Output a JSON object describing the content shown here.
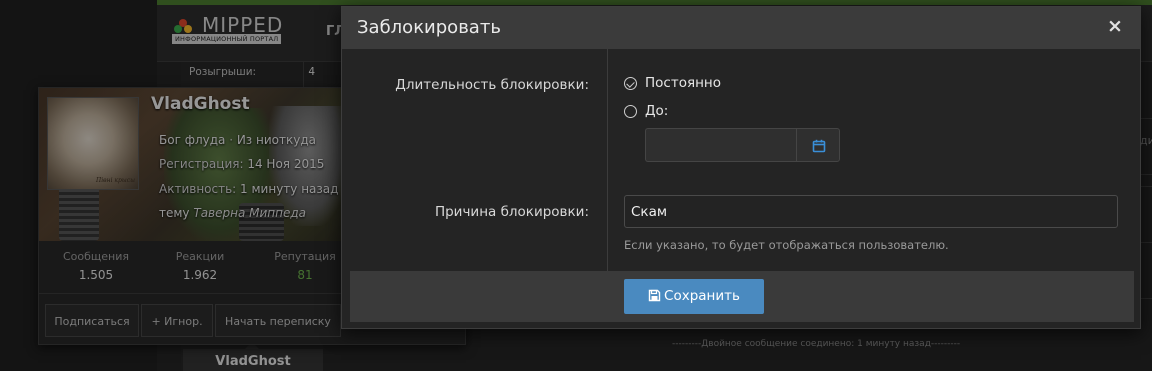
{
  "site": {
    "logo_text": "MIPPED",
    "logo_subtext": "ИНФОРМАЦИОННЫЙ ПОРТАЛ",
    "nav_fragment": "ГЛ"
  },
  "sidebar_stats": {
    "label": "Розыгрыши:",
    "value": "4"
  },
  "member_card": {
    "avatar_caption": "Пiвнi крысы",
    "username": "VladGhost",
    "title": "Бог флуда",
    "location": "Из ниоткуда",
    "separator": " · ",
    "registration_label": "Регистрация:",
    "registration_date": "14 Ноя 2015",
    "activity_label": "Активность:",
    "activity_value": "1 минуту назад ·",
    "thread_prefix": "тему",
    "thread_name": "Таверна Миппеда",
    "stats": [
      {
        "label": "Сообщения",
        "value": "1.505"
      },
      {
        "label": "Реакции",
        "value": "1.962"
      },
      {
        "label": "Репутация",
        "value": "81"
      }
    ],
    "buttons": {
      "follow": "Подписаться",
      "ignore": "+ Игнор.",
      "message": "Начать переписку"
    }
  },
  "post_author": "VladGhost",
  "merged_note": "---------Двойное сообщение соединено: 1 минуту назад---------",
  "right_fragment": "ди",
  "modal": {
    "title": "Заблокировать",
    "close": "×",
    "duration_label": "Длительность блокировки:",
    "options": [
      {
        "label": "Постоянно",
        "checked": true
      },
      {
        "label": "До:",
        "checked": false
      }
    ],
    "date_value": "",
    "reason_label": "Причина блокировки:",
    "reason_value": "Скам",
    "reason_hint": "Если указано, то будет отображаться пользователю.",
    "save_label": "Сохранить"
  },
  "colors": {
    "accent": "#4a8ac0",
    "positive": "#6bb04a",
    "calendar_icon": "#3a8fd8"
  }
}
